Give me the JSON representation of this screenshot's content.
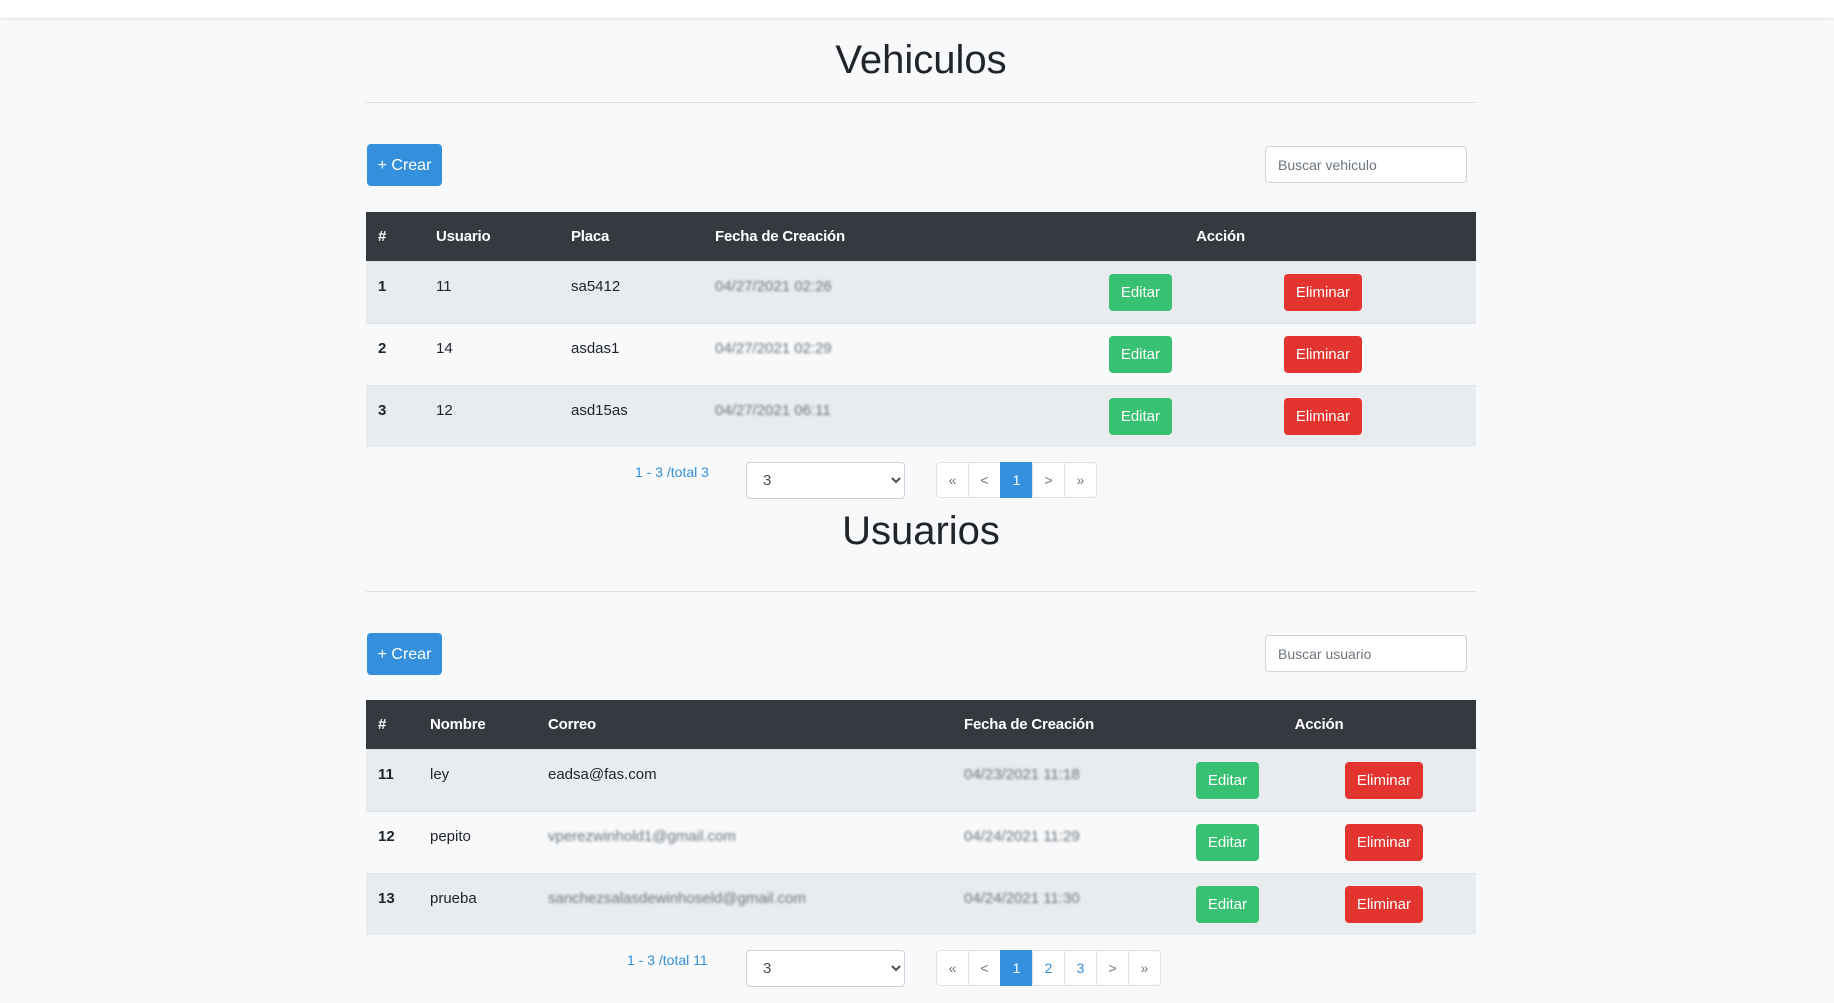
{
  "vehicles": {
    "title": "Vehiculos",
    "create_label": "+ Crear",
    "search_placeholder": "Buscar vehiculo",
    "columns": [
      "#",
      "Usuario",
      "Placa",
      "Fecha de Creación",
      "Acción"
    ],
    "rows": [
      {
        "id": "1",
        "user": "11",
        "plate": "sa5412",
        "created": "04/27/2021 02:26"
      },
      {
        "id": "2",
        "user": "14",
        "plate": "asdas1",
        "created": "04/27/2021 02:29"
      },
      {
        "id": "3",
        "user": "12",
        "plate": "asd15as",
        "created": "04/27/2021 06:11"
      }
    ],
    "edit_label": "Editar",
    "delete_label": "Eliminar",
    "range": "1 - 3 /total 3",
    "per_page": "3",
    "pagination": [
      "«",
      "<",
      "1",
      ">",
      "»"
    ],
    "active_page": "1"
  },
  "users": {
    "title": "Usuarios",
    "create_label": "+ Crear",
    "search_placeholder": "Buscar usuario",
    "columns": [
      "#",
      "Nombre",
      "Correo",
      "Fecha de Creación",
      "Acción"
    ],
    "rows": [
      {
        "id": "11",
        "name": "ley",
        "email": "eadsa@fas.com",
        "created": "04/23/2021 11:18"
      },
      {
        "id": "12",
        "name": "pepito",
        "email": "vperezwinhold1@gmail.com",
        "created": "04/24/2021 11:29"
      },
      {
        "id": "13",
        "name": "prueba",
        "email": "sanchezsalasdewinhoseld@gmail.com",
        "created": "04/24/2021 11:30"
      }
    ],
    "edit_label": "Editar",
    "delete_label": "Eliminar",
    "range": "1 - 3 /total 11",
    "per_page": "3",
    "pagination": [
      "«",
      "<",
      "1",
      "2",
      "3",
      ">",
      "»"
    ],
    "active_page": "1"
  },
  "colors": {
    "primary": "#3490dc",
    "success": "#38c172",
    "danger": "#e3342f",
    "table_header": "#343a40"
  }
}
